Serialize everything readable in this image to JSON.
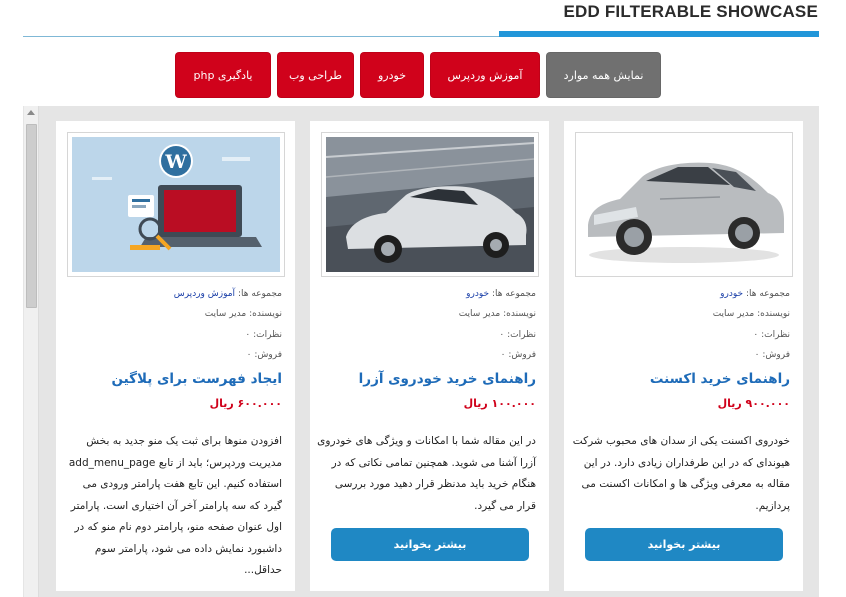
{
  "header": {
    "title": "EDD FILTERABLE SHOWCASE"
  },
  "filters": [
    {
      "label": "نمایش همه موارد",
      "active": true
    },
    {
      "label": "آموزش وردپرس",
      "active": false
    },
    {
      "label": "خودرو",
      "active": false
    },
    {
      "label": "طراحی وب",
      "active": false
    },
    {
      "label": "یادگیری php",
      "active": false
    }
  ],
  "labels": {
    "category": "مجموعه ها:",
    "author": "نویسنده:",
    "comments": "نظرات:",
    "sales": "فروش:",
    "read_more": "بیشتر بخوانید"
  },
  "products": [
    {
      "image_icon": "car-photo",
      "category": "خودرو",
      "author": "مدیر سایت",
      "comments": "۰",
      "sales": "۰",
      "title": "راهنمای خرید اکسنت",
      "price": "۹۰۰.۰۰۰ ریال",
      "description": "خودروی اکسنت یکی از سدان های محبوب شرکت هیوندای که در این طرفداران زیادی دارد. در این مقاله به معرفی ویژگی ها و امکانات اکسنت می پردازیم."
    },
    {
      "image_icon": "car-photo",
      "category": "خودرو",
      "author": "مدیر سایت",
      "comments": "۰",
      "sales": "۰",
      "title": "راهنمای خرید خودروی آزرا",
      "price": "۱۰۰.۰۰۰ ریال",
      "description": "در این مقاله شما با امکانات و ویژگی های خودروی آزرا آشنا می شوید. همچنین تمامی نکاتی که در هنگام خرید باید مدنظر قرار دهید مورد بررسی قرار می گیرد."
    },
    {
      "image_icon": "wordpress-illustration",
      "category": "آموزش وردپرس",
      "author": "مدیر سایت",
      "comments": "۰",
      "sales": "۰",
      "title": "ایجاد فهرست برای پلاگین",
      "price": "۶۰۰.۰۰۰ ریال",
      "description": "افزودن منوها برای ثبت یک منو جدید به بخش مدیریت وردپرس؛ باید از تابع add_menu_page استفاده کنیم. این تابع هفت پارامتر ورودی می گیرد که سه پارامتر آخر آن اختیاری است. پارامتر اول عنوان صفحه منو، پارامتر دوم نام منو که در داشبورد نمایش داده می شود، پارامتر سوم حداقل..."
    }
  ],
  "colors": {
    "accent_blue": "#2196d9",
    "filter_red": "#d0021b",
    "filter_active": "#707070",
    "title_blue": "#1e6bb8",
    "button_blue": "#1f88c4"
  }
}
